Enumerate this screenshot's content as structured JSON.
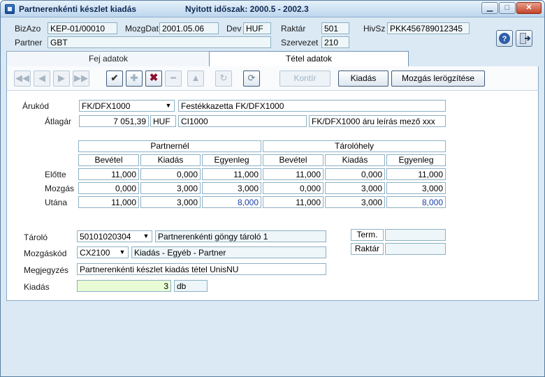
{
  "window": {
    "title": "Partnerenkénti készlet kiadás",
    "period": "Nyitott időszak: 2000.5 - 2002.3",
    "minimize": "▁",
    "maximize": "□",
    "close": "✕"
  },
  "header": {
    "bizazo_label": "BizAzo",
    "bizazo_value": "KEP-01/00010",
    "mozgdat_label": "MozgDat",
    "mozgdat_value": "2001.05.06",
    "dev_label": "Dev",
    "dev_value": "HUF",
    "raktar_label": "Raktár",
    "raktar_value": "501",
    "hivsz_label": "HivSz",
    "hivsz_value": "PKK456789012345",
    "partner_label": "Partner",
    "partner_value": "GBT",
    "szervezet_label": "Szervezet",
    "szervezet_value": "210"
  },
  "tabs": [
    {
      "label": "Fej adatok",
      "active": false
    },
    {
      "label": "Tétel adatok",
      "active": true
    }
  ],
  "toolbar": {
    "first": "◀◀",
    "prev": "◀",
    "next": "▶",
    "last": "▶▶",
    "confirm": "✔",
    "add": "✚",
    "cancel": "✖",
    "remove": "━",
    "up": "▲",
    "refresh": "↻",
    "history": "⟳",
    "kontir_label": "Kontír",
    "kiadas_label": "Kiadás",
    "mozgas_label": "Mozgás lerögzítése"
  },
  "item": {
    "arukod_label": "Árukód",
    "arukod_value": "FK/DFX1000",
    "arukod_desc": "Festékkazetta FK/DFX1000",
    "atlagar_label": "Átlagár",
    "atlagar_value": "7 051,39",
    "atlagar_currency": "HUF",
    "atlagar_code": "CI1000",
    "atlagar_desc": "FK/DFX1000 áru leírás mező xxx"
  },
  "grid": {
    "group1": "Partnernél",
    "group2": "Tárolóhely",
    "columns": [
      "Bevétel",
      "Kiadás",
      "Egyenleg",
      "Bevétel",
      "Kiadás",
      "Egyenleg"
    ],
    "rows": [
      {
        "label": "Előtte",
        "values": [
          "11,000",
          "0,000",
          "11,000",
          "11,000",
          "0,000",
          "11,000"
        ]
      },
      {
        "label": "Mozgás",
        "values": [
          "0,000",
          "3,000",
          "3,000",
          "0,000",
          "3,000",
          "3,000"
        ]
      },
      {
        "label": "Utána",
        "values": [
          "11,000",
          "3,000",
          "8,000",
          "11,000",
          "3,000",
          "8,000"
        ]
      }
    ]
  },
  "bottom": {
    "tarolo_label": "Tároló",
    "tarolo_value": "50101020304",
    "tarolo_desc": "Partnerenkénti göngy tároló 1",
    "mozgaskod_label": "Mozgáskód",
    "mozgaskod_value": "CX2100",
    "mozgaskod_desc": "Kiadás - Egyéb - Partner",
    "megjegyzes_label": "Megjegyzés",
    "megjegyzes_value": "Partnerenkénti készlet kiadás tétel UnisNU",
    "kiadas_label": "Kiadás",
    "kiadas_value": "3",
    "kiadas_unit": "db",
    "term_label": "Term.",
    "raktar_label": "Raktár"
  }
}
